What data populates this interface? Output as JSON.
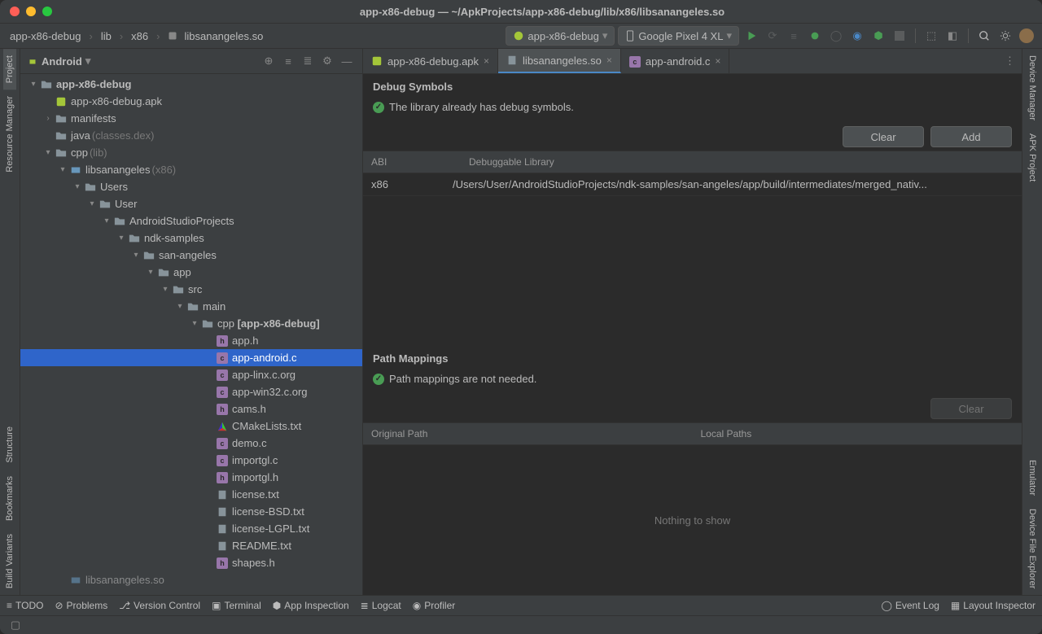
{
  "title": "app-x86-debug — ~/ApkProjects/app-x86-debug/lib/x86/libsanangeles.so",
  "breadcrumb": [
    "app-x86-debug",
    "lib",
    "x86",
    "libsanangeles.so"
  ],
  "run_config": "app-x86-debug",
  "device": "Google Pixel 4 XL",
  "left_rail": [
    "Project",
    "Resource Manager",
    "Structure",
    "Bookmarks",
    "Build Variants"
  ],
  "right_rail": [
    "Device Manager",
    "APK Project",
    "Emulator",
    "Device File Explorer"
  ],
  "sidebar": {
    "dropdown": "Android"
  },
  "tree": [
    {
      "d": 0,
      "tw": "▾",
      "i": "folder",
      "t": "app-x86-debug",
      "bold": true
    },
    {
      "d": 1,
      "tw": "",
      "i": "apk",
      "t": "app-x86-debug.apk"
    },
    {
      "d": 1,
      "tw": "›",
      "i": "folder",
      "t": "manifests"
    },
    {
      "d": 1,
      "tw": "",
      "i": "folder",
      "t": "java",
      "dim": "(classes.dex)"
    },
    {
      "d": 1,
      "tw": "▾",
      "i": "folder",
      "t": "cpp",
      "dim": "(lib)"
    },
    {
      "d": 2,
      "tw": "▾",
      "i": "lib",
      "t": "libsanangeles",
      "dim": "(x86)"
    },
    {
      "d": 3,
      "tw": "▾",
      "i": "folder",
      "t": "Users"
    },
    {
      "d": 4,
      "tw": "▾",
      "i": "folder",
      "t": "User"
    },
    {
      "d": 5,
      "tw": "▾",
      "i": "folder",
      "t": "AndroidStudioProjects"
    },
    {
      "d": 6,
      "tw": "▾",
      "i": "folder",
      "t": "ndk-samples"
    },
    {
      "d": 7,
      "tw": "▾",
      "i": "folder",
      "t": "san-angeles"
    },
    {
      "d": 8,
      "tw": "▾",
      "i": "folder",
      "t": "app"
    },
    {
      "d": 9,
      "tw": "▾",
      "i": "folder",
      "t": "src"
    },
    {
      "d": 10,
      "tw": "▾",
      "i": "folder",
      "t": "main"
    },
    {
      "d": 11,
      "tw": "▾",
      "i": "folder-cpp",
      "t": "cpp",
      "bold_suffix": "[app-x86-debug]"
    },
    {
      "d": 12,
      "tw": "",
      "i": "h",
      "t": "app.h"
    },
    {
      "d": 12,
      "tw": "",
      "i": "c",
      "t": "app-android.c",
      "sel": true
    },
    {
      "d": 12,
      "tw": "",
      "i": "c",
      "t": "app-linx.c.org"
    },
    {
      "d": 12,
      "tw": "",
      "i": "c",
      "t": "app-win32.c.org"
    },
    {
      "d": 12,
      "tw": "",
      "i": "h",
      "t": "cams.h"
    },
    {
      "d": 12,
      "tw": "",
      "i": "cmake",
      "t": "CMakeLists.txt"
    },
    {
      "d": 12,
      "tw": "",
      "i": "c",
      "t": "demo.c"
    },
    {
      "d": 12,
      "tw": "",
      "i": "c",
      "t": "importgl.c"
    },
    {
      "d": 12,
      "tw": "",
      "i": "h",
      "t": "importgl.h"
    },
    {
      "d": 12,
      "tw": "",
      "i": "txt",
      "t": "license.txt"
    },
    {
      "d": 12,
      "tw": "",
      "i": "txt",
      "t": "license-BSD.txt"
    },
    {
      "d": 12,
      "tw": "",
      "i": "txt",
      "t": "license-LGPL.txt"
    },
    {
      "d": 12,
      "tw": "",
      "i": "txt",
      "t": "README.txt"
    },
    {
      "d": 12,
      "tw": "",
      "i": "h",
      "t": "shapes.h"
    },
    {
      "d": 2,
      "tw": "",
      "i": "lib",
      "t": "libsanangeles.so",
      "trunc": true
    }
  ],
  "editor_tabs": [
    {
      "label": "app-x86-debug.apk",
      "i": "apk"
    },
    {
      "label": "libsanangeles.so",
      "i": "so",
      "active": true
    },
    {
      "label": "app-android.c",
      "i": "c"
    }
  ],
  "debug_symbols": {
    "heading": "Debug Symbols",
    "msg": "The library already has debug symbols.",
    "clear_btn": "Clear",
    "add_btn": "Add",
    "col_abi": "ABI",
    "col_lib": "Debuggable Library",
    "row_abi": "x86",
    "row_lib": "/Users/User/AndroidStudioProjects/ndk-samples/san-angeles/app/build/intermediates/merged_nativ..."
  },
  "path_mappings": {
    "heading": "Path Mappings",
    "msg": "Path mappings are not needed.",
    "clear_btn": "Clear",
    "col_orig": "Original Path",
    "col_local": "Local Paths",
    "empty": "Nothing to show"
  },
  "status": {
    "todo": "TODO",
    "problems": "Problems",
    "vcs": "Version Control",
    "terminal": "Terminal",
    "app_inspection": "App Inspection",
    "logcat": "Logcat",
    "profiler": "Profiler",
    "event_log": "Event Log",
    "layout_inspector": "Layout Inspector"
  }
}
